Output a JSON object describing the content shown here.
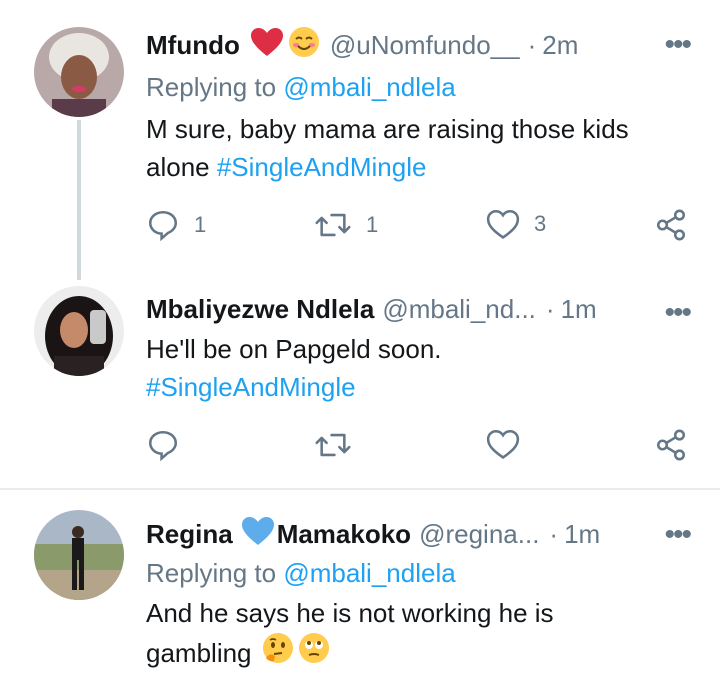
{
  "tweets": [
    {
      "name": "Mfundo",
      "handle": "@uNomfundo__",
      "dot": "·",
      "time": "2m",
      "replying_label": "Replying to",
      "replying_to": "@mbali_ndlela",
      "text_parts": [
        "M sure, baby mama are raising those kids alone ",
        "#SingleAndMingle"
      ],
      "reply_count": "1",
      "retweet_count": "1",
      "like_count": "3"
    },
    {
      "name": "Mbaliyezwe Ndlela",
      "handle": "@mbali_nd...",
      "dot": "·",
      "time": "1m",
      "text_parts": [
        "He'll be on Papgeld soon.",
        "#SingleAndMingle"
      ],
      "reply_count": "",
      "retweet_count": "",
      "like_count": ""
    },
    {
      "name_first": "Regina",
      "name_second": "Mamakoko",
      "handle": "@regina...",
      "dot": "·",
      "time": "1m",
      "replying_label": "Replying to",
      "replying_to": "@mbali_ndlela",
      "text_parts": [
        "And he says he is not working he is",
        "gambling"
      ]
    }
  ],
  "colors": {
    "link": "#1da1f2",
    "muted": "#657786",
    "heart": "#e0245e",
    "blue_heart": "#5dadec"
  },
  "icons": [
    "heart-icon",
    "smiling-face-icon",
    "reply-icon",
    "retweet-icon",
    "like-icon",
    "share-icon",
    "more-icon",
    "blue-heart-icon",
    "thinking-face-icon",
    "eye-roll-face-icon"
  ]
}
